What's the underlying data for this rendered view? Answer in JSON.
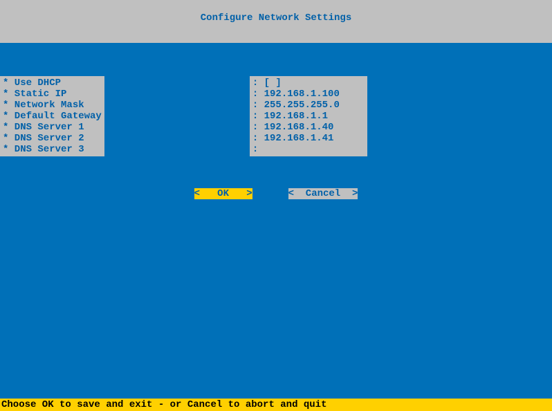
{
  "header": {
    "title": "Configure Network Settings"
  },
  "form": {
    "rows": [
      {
        "label": "* Use DHCP",
        "value": ": [ ]"
      },
      {
        "label": "* Static IP",
        "value": ": 192.168.1.100"
      },
      {
        "label": "* Network Mask",
        "value": ": 255.255.255.0"
      },
      {
        "label": "* Default Gateway",
        "value": ": 192.168.1.1"
      },
      {
        "label": "* DNS Server 1",
        "value": ": 192.168.1.40"
      },
      {
        "label": "* DNS Server 2",
        "value": ": 192.168.1.41"
      },
      {
        "label": "* DNS Server 3",
        "value": ":"
      }
    ]
  },
  "buttons": {
    "ok": "<   OK   >",
    "cancel": "<  Cancel  >"
  },
  "footer": {
    "hint": "Choose OK to save and exit - or Cancel to abort and quit"
  }
}
